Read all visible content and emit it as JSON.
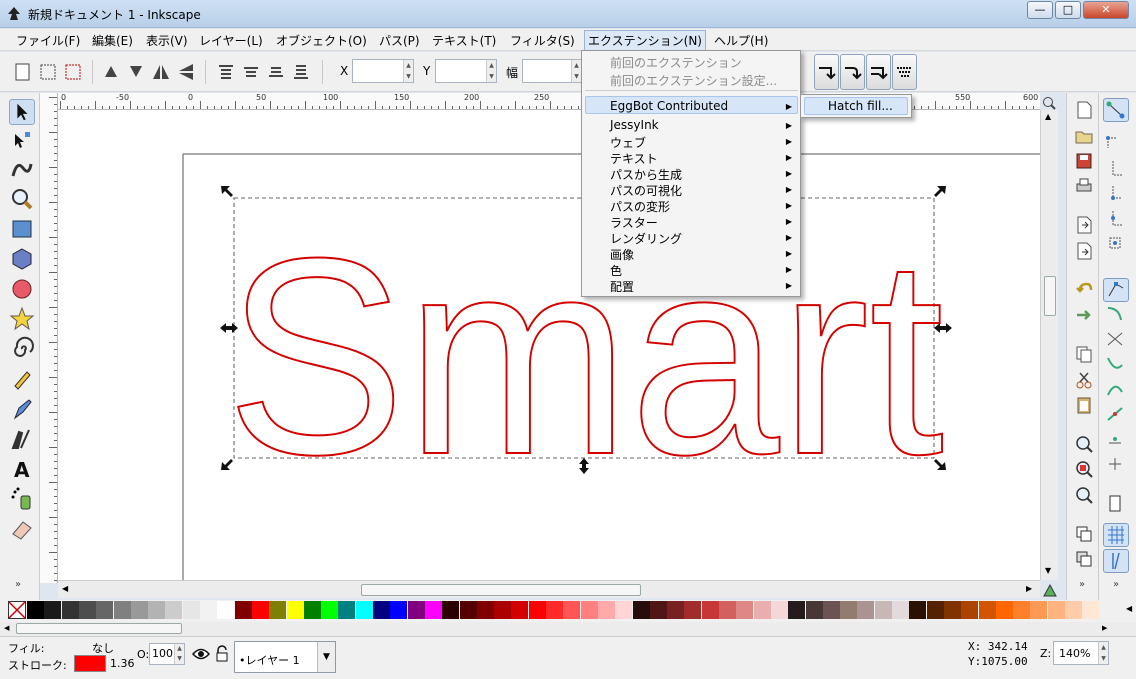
{
  "window": {
    "title": "新規ドキュメント 1 - Inkscape",
    "btn_min": "—",
    "btn_max": "□",
    "btn_close": "✕"
  },
  "menubar": {
    "items": [
      "ファイル(F)",
      "編集(E)",
      "表示(V)",
      "レイヤー(L)",
      "オブジェクト(O)",
      "パス(P)",
      "テキスト(T)",
      "フィルタ(S)",
      "エクステンション(N)",
      "ヘルプ(H)"
    ]
  },
  "toolbar": {
    "x_label": "X",
    "y_label": "Y",
    "w_label": "幅"
  },
  "ruler": {
    "labels": [
      "0",
      "-50",
      "0",
      "50",
      "100",
      "150",
      "200",
      "250",
      "550",
      "600"
    ]
  },
  "canvas": {
    "text": "Smart",
    "stroke_color": "#d40000"
  },
  "extensions_menu": {
    "items": [
      {
        "label": "前回のエクステンション",
        "disabled": true,
        "submenu": false
      },
      {
        "label": "前回のエクステンション設定...",
        "disabled": true,
        "submenu": false
      },
      {
        "label": "EggBot Contributed",
        "disabled": false,
        "submenu": true,
        "highlighted": true
      },
      {
        "label": "JessyInk",
        "submenu": true
      },
      {
        "label": "ウェブ",
        "submenu": true
      },
      {
        "label": "テキスト",
        "submenu": true
      },
      {
        "label": "パスから生成",
        "submenu": true
      },
      {
        "label": "パスの可視化",
        "submenu": true
      },
      {
        "label": "パスの変形",
        "submenu": true
      },
      {
        "label": "ラスター",
        "submenu": true
      },
      {
        "label": "レンダリング",
        "submenu": true
      },
      {
        "label": "画像",
        "submenu": true
      },
      {
        "label": "色",
        "submenu": true
      },
      {
        "label": "配置",
        "submenu": true
      }
    ],
    "submenu": {
      "label": "Hatch fill..."
    }
  },
  "palette": {
    "colors": [
      "#000000",
      "#1a1a1a",
      "#333333",
      "#4d4d4d",
      "#666666",
      "#808080",
      "#999999",
      "#b3b3b3",
      "#cccccc",
      "#e6e6e6",
      "#f2f2f2",
      "#ffffff",
      "#800000",
      "#ff0000",
      "#808000",
      "#ffff00",
      "#008000",
      "#00ff00",
      "#008080",
      "#00ffff",
      "#000080",
      "#0000ff",
      "#800080",
      "#ff00ff",
      "#2b0000",
      "#550000",
      "#800000",
      "#aa0000",
      "#d40000",
      "#ff0000",
      "#ff2a2a",
      "#ff5555",
      "#ff8080",
      "#ffaaaa",
      "#ffd5d5",
      "#280b0b",
      "#501616",
      "#782121",
      "#a02c2c",
      "#c83737",
      "#d35f5f",
      "#de8787",
      "#e9afaf",
      "#f4d7d7",
      "#241c1c",
      "#483737",
      "#6c5353",
      "#917c6f",
      "#ac9393",
      "#c8b7b7",
      "#e3dbdb",
      "#2b1100",
      "#552200",
      "#803300",
      "#aa4400",
      "#d45500",
      "#ff6600",
      "#ff7f2a",
      "#ff9955",
      "#ffb380",
      "#ffccaa",
      "#ffe6d5"
    ]
  },
  "status": {
    "fill_label": "フィル:",
    "fill_value": "なし",
    "stroke_label": "ストローク:",
    "stroke_width": "1.36",
    "opacity_label": "O:",
    "opacity_value": "100",
    "layer": "•レイヤー 1",
    "x_coord": "X:  342.14",
    "y_coord": "Y:1075.00",
    "zoom_label": "Z:",
    "zoom_value": "140%"
  },
  "colors": {
    "stroke": "#ff0000",
    "highlight": "#d6e6f8"
  }
}
